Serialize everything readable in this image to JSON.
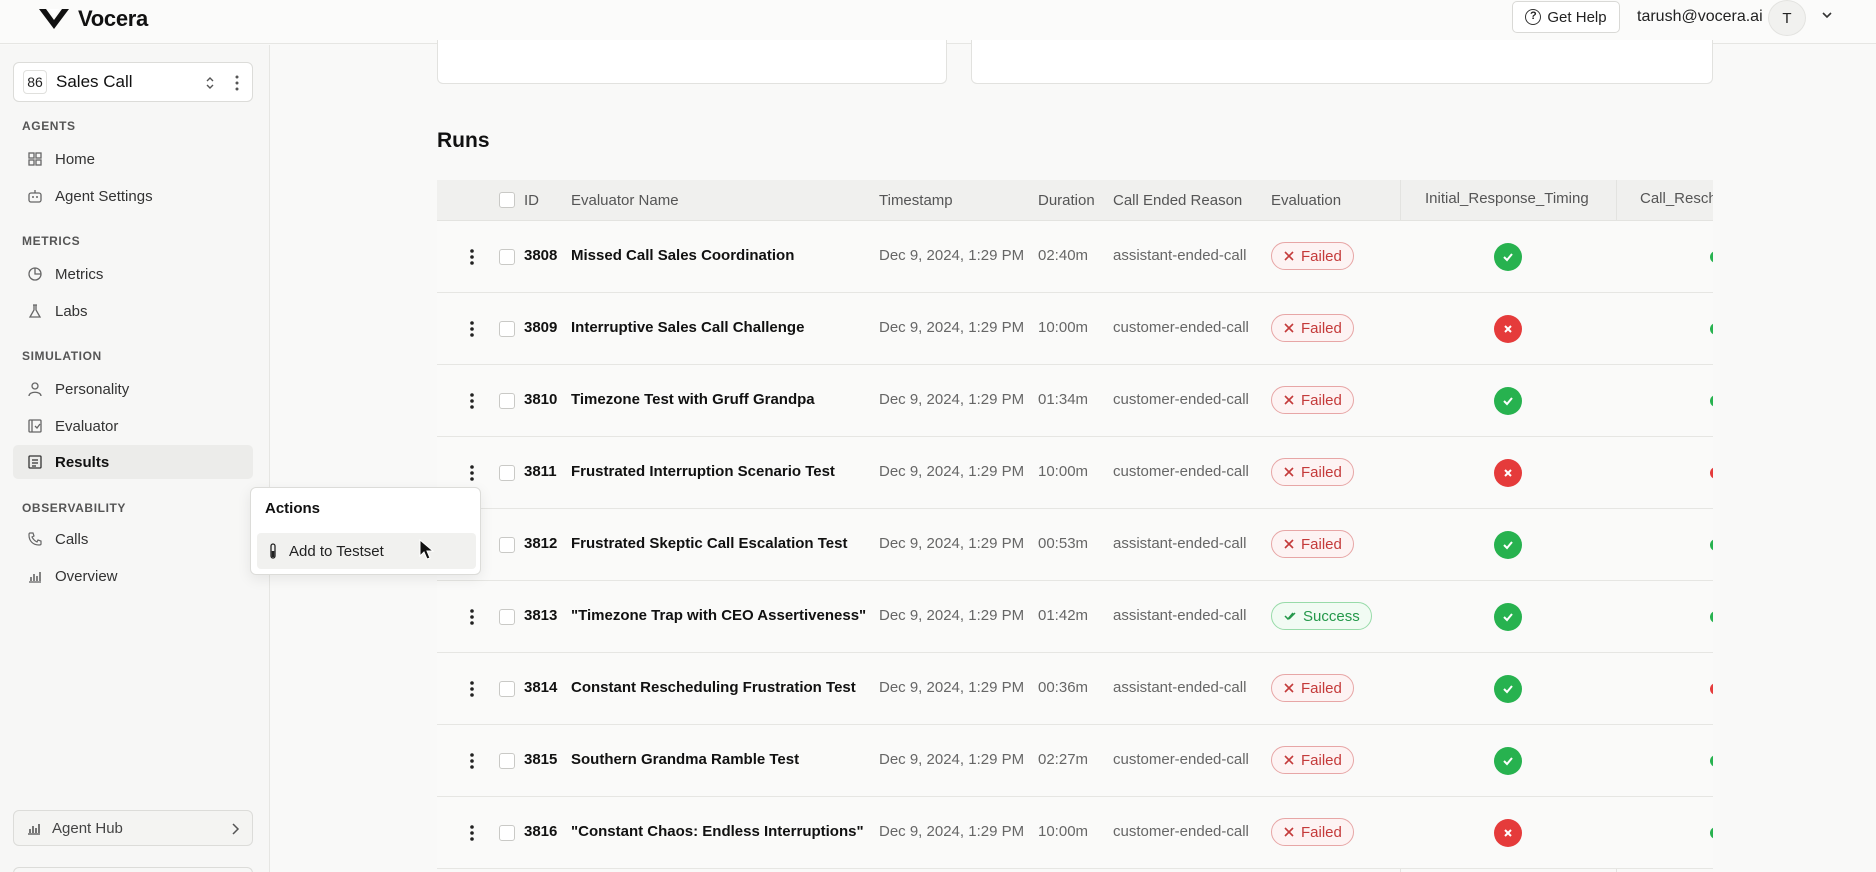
{
  "app": {
    "name": "Vocera",
    "help_label": "Get Help",
    "user_email": "tarush@vocera.ai",
    "avatar_initial": "T"
  },
  "project": {
    "number": "86",
    "name": "Sales Call"
  },
  "sidebar": {
    "sections": {
      "agents": "AGENTS",
      "metrics": "METRICS",
      "simulation": "SIMULATION",
      "observability": "OBSERVABILITY"
    },
    "items": {
      "home": "Home",
      "agent_settings": "Agent Settings",
      "metrics": "Metrics",
      "labs": "Labs",
      "personality": "Personality",
      "evaluator": "Evaluator",
      "results": "Results",
      "calls": "Calls",
      "overview": "Overview"
    },
    "agent_hub": "Agent Hub"
  },
  "runs": {
    "title": "Runs",
    "columns": {
      "id": "ID",
      "evaluator_name": "Evaluator Name",
      "timestamp": "Timestamp",
      "duration": "Duration",
      "call_ended_reason": "Call Ended Reason",
      "evaluation": "Evaluation",
      "metric1": "Initial_Response_Timing",
      "metric2": "Call_Resch"
    },
    "rows": [
      {
        "id": "3808",
        "name": "Missed Call Sales Coordination",
        "timestamp": "Dec 9, 2024, 1:29 PM",
        "duration": "02:40m",
        "reason": "assistant-ended-call",
        "evaluation": "Failed",
        "metric1": "pass",
        "metric2": "pass"
      },
      {
        "id": "3809",
        "name": "Interruptive Sales Call Challenge",
        "timestamp": "Dec 9, 2024, 1:29 PM",
        "duration": "10:00m",
        "reason": "customer-ended-call",
        "evaluation": "Failed",
        "metric1": "fail",
        "metric2": "pass"
      },
      {
        "id": "3810",
        "name": "Timezone Test with Gruff Grandpa",
        "timestamp": "Dec 9, 2024, 1:29 PM",
        "duration": "01:34m",
        "reason": "customer-ended-call",
        "evaluation": "Failed",
        "metric1": "pass",
        "metric2": "pass"
      },
      {
        "id": "3811",
        "name": "Frustrated Interruption Scenario Test",
        "timestamp": "Dec 9, 2024, 1:29 PM",
        "duration": "10:00m",
        "reason": "customer-ended-call",
        "evaluation": "Failed",
        "metric1": "fail",
        "metric2": "fail"
      },
      {
        "id": "3812",
        "name": "Frustrated Skeptic Call Escalation Test",
        "timestamp": "Dec 9, 2024, 1:29 PM",
        "duration": "00:53m",
        "reason": "assistant-ended-call",
        "evaluation": "Failed",
        "metric1": "pass",
        "metric2": "pass"
      },
      {
        "id": "3813",
        "name": "\"Timezone Trap with CEO Assertiveness\"",
        "timestamp": "Dec 9, 2024, 1:29 PM",
        "duration": "01:42m",
        "reason": "assistant-ended-call",
        "evaluation": "Success",
        "metric1": "pass",
        "metric2": "pass"
      },
      {
        "id": "3814",
        "name": "Constant Rescheduling Frustration Test",
        "timestamp": "Dec 9, 2024, 1:29 PM",
        "duration": "00:36m",
        "reason": "assistant-ended-call",
        "evaluation": "Failed",
        "metric1": "pass",
        "metric2": "fail"
      },
      {
        "id": "3815",
        "name": "Southern Grandma Ramble Test",
        "timestamp": "Dec 9, 2024, 1:29 PM",
        "duration": "02:27m",
        "reason": "customer-ended-call",
        "evaluation": "Failed",
        "metric1": "pass",
        "metric2": "pass"
      },
      {
        "id": "3816",
        "name": "\"Constant Chaos: Endless Interruptions\"",
        "timestamp": "Dec 9, 2024, 1:29 PM",
        "duration": "10:00m",
        "reason": "customer-ended-call",
        "evaluation": "Failed",
        "metric1": "fail",
        "metric2": "pass"
      }
    ]
  },
  "popover": {
    "title": "Actions",
    "add_to_testset": "Add to Testset"
  },
  "icons": {
    "help": "help-circle-icon",
    "kebab": "more-vertical-icon",
    "failed": "x-icon",
    "success": "double-check-icon"
  },
  "colors": {
    "pass": "#27b24f",
    "fail": "#e53b3b",
    "failed_text": "#c43a3a",
    "success_text": "#24984a"
  }
}
